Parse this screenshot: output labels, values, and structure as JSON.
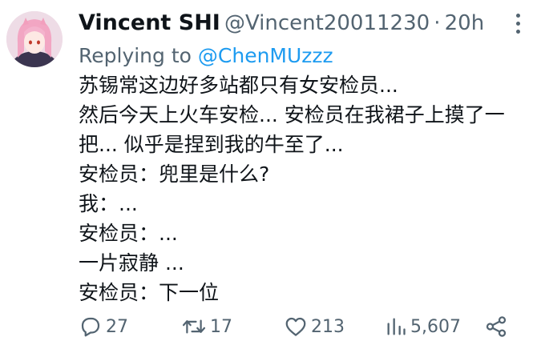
{
  "author": {
    "name": "Vincent SHI",
    "handle": "@Vincent20011230",
    "separator": "·",
    "time": "20h"
  },
  "reply": {
    "prefix": "Replying to ",
    "mention": "@ChenMUzzz"
  },
  "body_lines": [
    "苏锡常这边好多站都只有女安检员...",
    "然后今天上火车安检... 安检员在我裙子上摸了一",
    "把... 似乎是捏到我的牛至了...",
    "安检员：兜里是什么?",
    "我：...",
    "安检员：...",
    "一片寂静 ...",
    "安检员：下一位"
  ],
  "actions": {
    "replies": "27",
    "retweets": "17",
    "likes": "213",
    "views": "5,607"
  },
  "icons": {
    "reply": "reply-icon",
    "retweet": "retweet-icon",
    "like": "heart-icon",
    "views": "views-icon",
    "share": "share-icon",
    "more": "more-icon"
  },
  "colors": {
    "text": "#0f1419",
    "secondary": "#536471",
    "link": "#1d9bf0"
  }
}
